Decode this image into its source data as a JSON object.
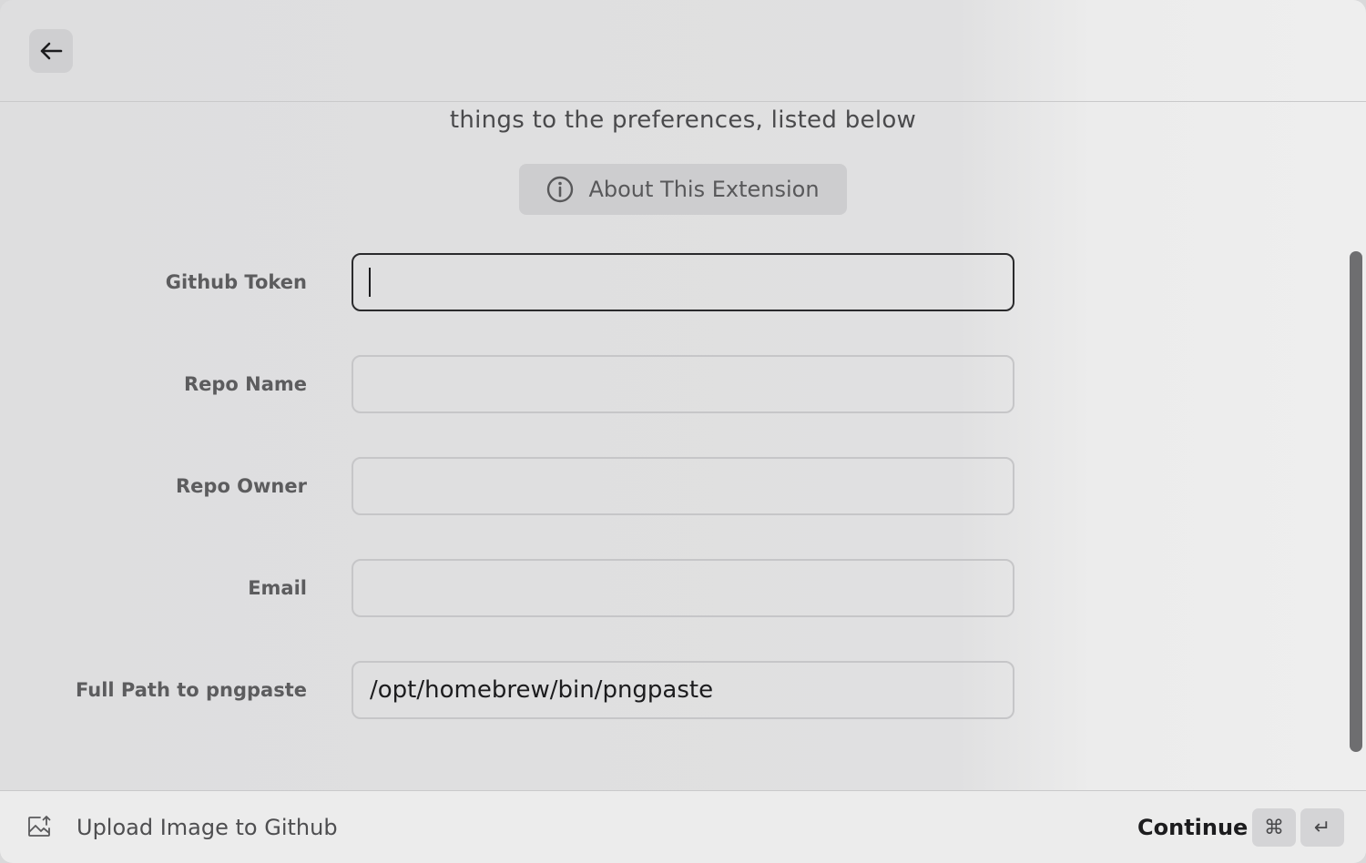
{
  "header": {
    "back_button_icon": "arrow-left-icon"
  },
  "content": {
    "intro_text": "things to the preferences, listed below",
    "about_button": {
      "label": "About This Extension",
      "icon": "info-circle-icon"
    },
    "fields": [
      {
        "label": "Github Token",
        "value": "",
        "focused": true
      },
      {
        "label": "Repo Name",
        "value": ""
      },
      {
        "label": "Repo Owner",
        "value": ""
      },
      {
        "label": "Email",
        "value": ""
      },
      {
        "label": "Full Path to pngpaste",
        "value": "/opt/homebrew/bin/pngpaste"
      }
    ]
  },
  "footer": {
    "command_icon": "image-upload-icon",
    "command_title": "Upload Image to Github",
    "action_label": "Continue",
    "shortcut_keys": [
      "⌘",
      "↵"
    ]
  }
}
